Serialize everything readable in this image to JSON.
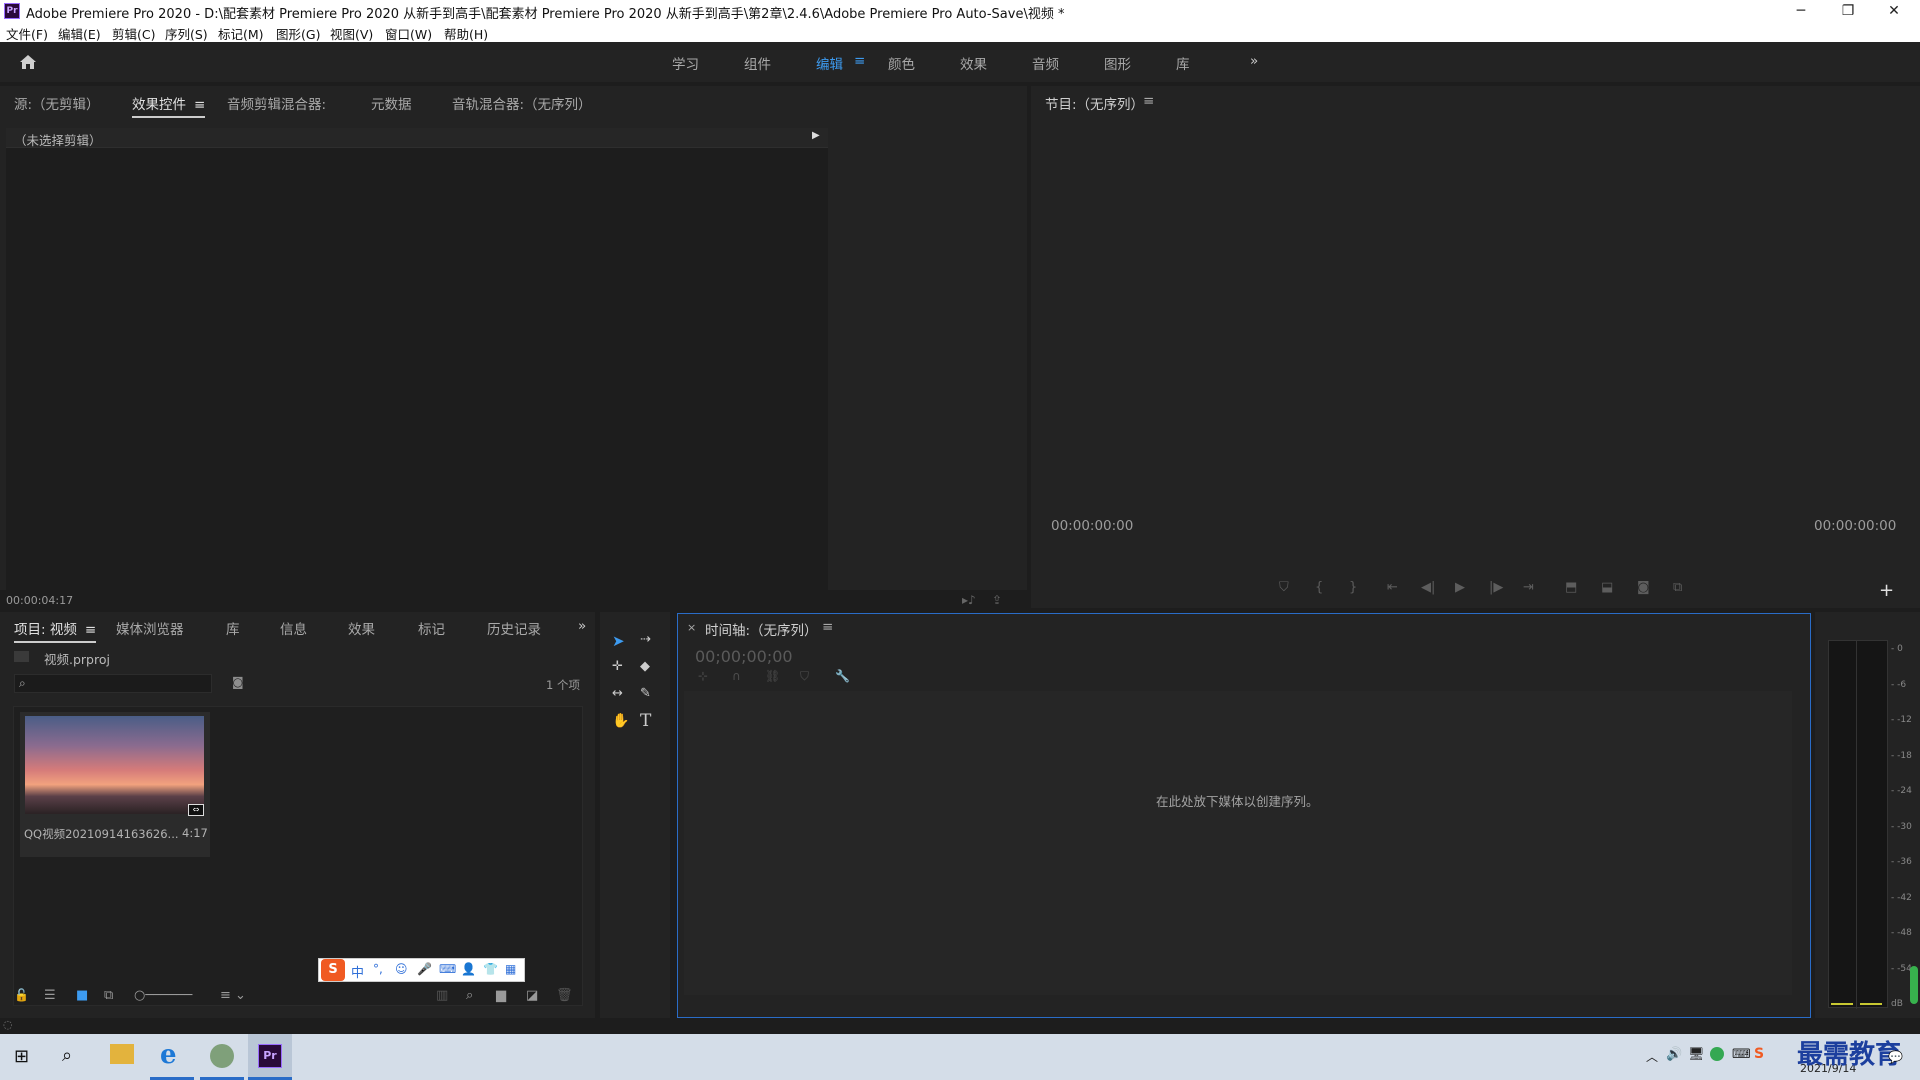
{
  "window": {
    "app_icon": "Pr",
    "title": "Adobe Premiere Pro 2020 - D:\\配套素材 Premiere Pro 2020 从新手到高手\\配套素材 Premiere Pro 2020 从新手到高手\\第2章\\2.4.6\\Adobe Premiere Pro Auto-Save\\视频 *",
    "minimize": "─",
    "restore": "❐",
    "close": "✕"
  },
  "menu": [
    "文件(F)",
    "编辑(E)",
    "剪辑(C)",
    "序列(S)",
    "标记(M)",
    "图形(G)",
    "视图(V)",
    "窗口(W)",
    "帮助(H)"
  ],
  "workspaces": {
    "items": [
      "学习",
      "组件",
      "编辑",
      "颜色",
      "效果",
      "音频",
      "图形",
      "库"
    ],
    "active": "编辑",
    "more": "»"
  },
  "source_panel": {
    "tabs": [
      "源:（无剪辑）",
      "效果控件",
      "音频剪辑混合器:",
      "元数据",
      "音轨混合器:（无序列）"
    ],
    "active_tab": "效果控件",
    "no_clip": "（未选择剪辑）",
    "timecode": "00:00:04:17"
  },
  "program_panel": {
    "tab": "节目:（无序列）",
    "timecode_left": "00:00:00:00",
    "timecode_right": "00:00:00:00"
  },
  "project_panel": {
    "tabs": [
      "项目: 视频",
      "媒体浏览器",
      "库",
      "信息",
      "效果",
      "标记",
      "历史记录"
    ],
    "active_tab": "项目: 视频",
    "more": "»",
    "file_name": "视频.prproj",
    "search_placeholder": "",
    "item_count": "1 个项",
    "clip": {
      "name": "QQ视频20210914163626...",
      "duration": "4:17"
    }
  },
  "timeline_panel": {
    "tab": "时间轴:（无序列）",
    "timecode": "00;00;00;00",
    "drop_hint": "在此处放下媒体以创建序列。"
  },
  "audio_meter": {
    "ticks": [
      "0",
      "-6",
      "-12",
      "-18",
      "-24",
      "-30",
      "-36",
      "-42",
      "-48",
      "-54",
      "dB"
    ]
  },
  "ime_toolbar": {
    "logo": "S",
    "mode": "中",
    "items": [
      "°,",
      "☺",
      "🎤",
      "⌨",
      "👤",
      "👕",
      "▦"
    ]
  },
  "taskbar": {
    "date": "2021/9/14",
    "watermark": "最需教育",
    "apps": [
      "start",
      "search",
      "explorer",
      "edge",
      "browser",
      "premiere"
    ]
  },
  "colors": {
    "accent": "#3d9bf0",
    "panel_bg": "#232323",
    "frame_bg": "#1d1d1d",
    "timeline_border": "#2a6cc7"
  }
}
